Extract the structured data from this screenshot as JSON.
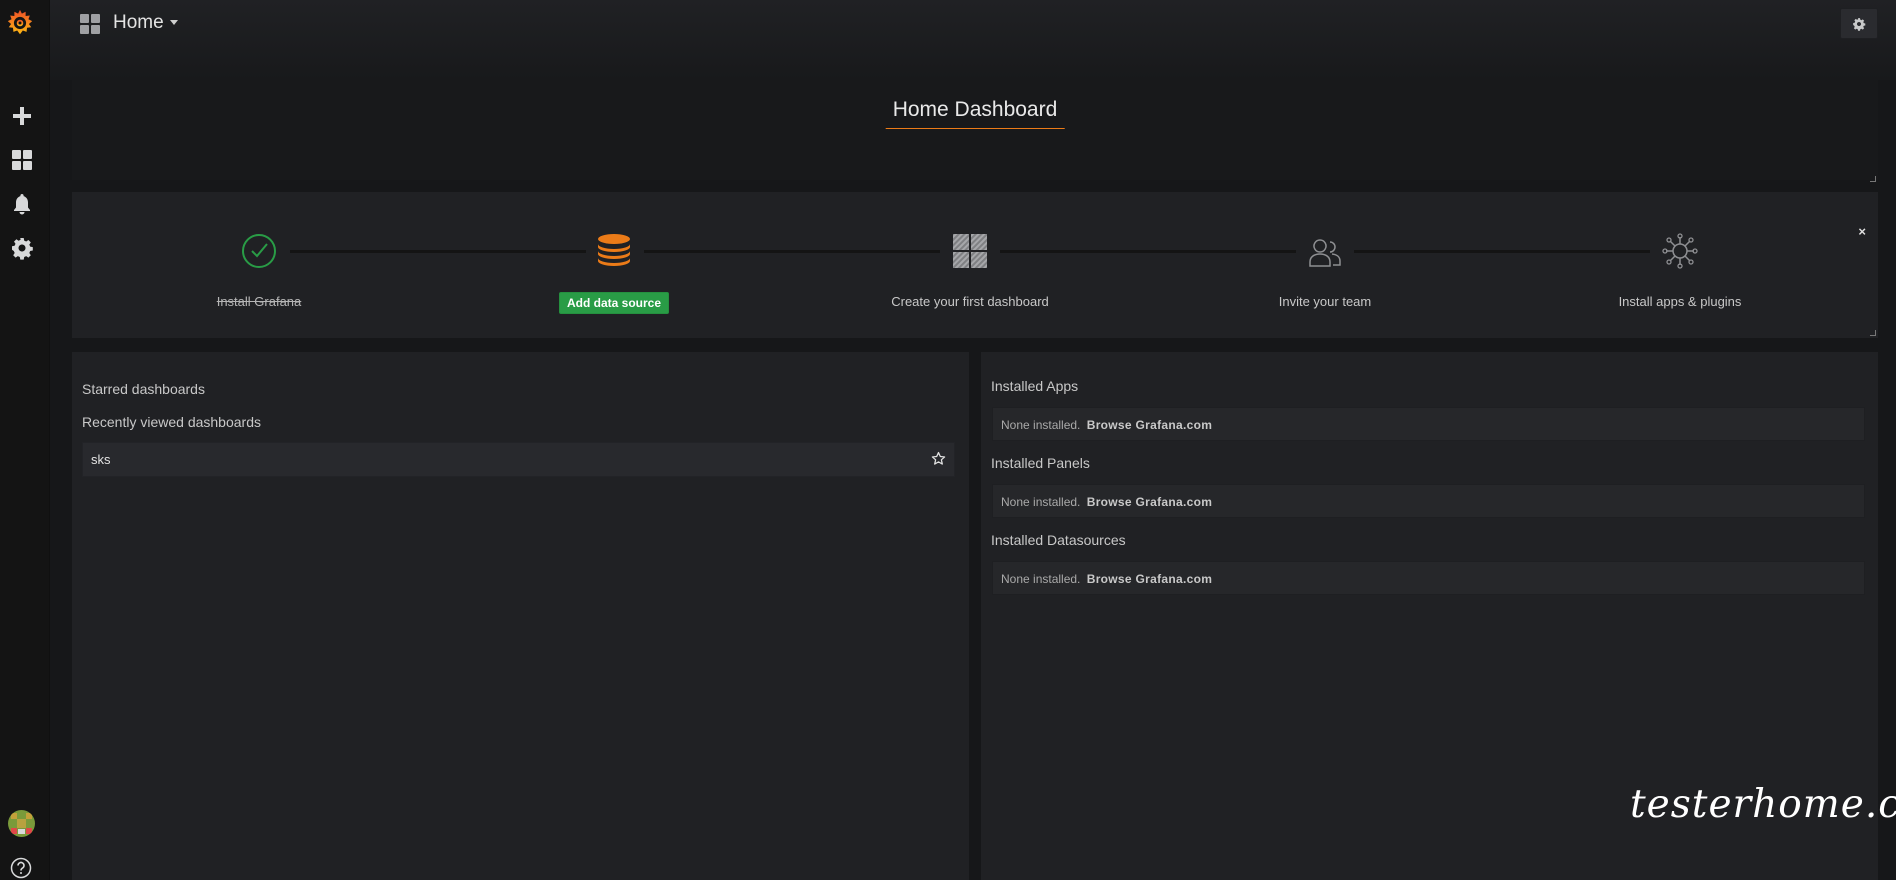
{
  "navbar": {
    "title": "Home"
  },
  "home": {
    "title": "Home Dashboard"
  },
  "getting_started": {
    "steps": [
      {
        "label": "Install Grafana",
        "state": "done",
        "icon": "check-circle-icon"
      },
      {
        "label": "Add data source",
        "state": "active",
        "icon": "database-icon"
      },
      {
        "label": "Create your first dashboard",
        "state": "todo",
        "icon": "dashboard-grid-icon"
      },
      {
        "label": "Invite your team",
        "state": "todo",
        "icon": "users-icon"
      },
      {
        "label": "Install apps & plugins",
        "state": "todo",
        "icon": "plugins-icon"
      }
    ],
    "close_label": "×"
  },
  "dashboards": {
    "starred_title": "Starred dashboards",
    "recent_title": "Recently viewed dashboards",
    "recent": [
      {
        "name": "sks"
      }
    ]
  },
  "plugins": {
    "apps_title": "Installed Apps",
    "panels_title": "Installed Panels",
    "datasources_title": "Installed Datasources",
    "none_text": "None installed.",
    "browse_link": "Browse Grafana.com"
  },
  "watermark": "testerhome.com",
  "colors": {
    "accent": "#eb7b18",
    "success": "#299c46",
    "background": "#161719",
    "panel": "#202124"
  }
}
